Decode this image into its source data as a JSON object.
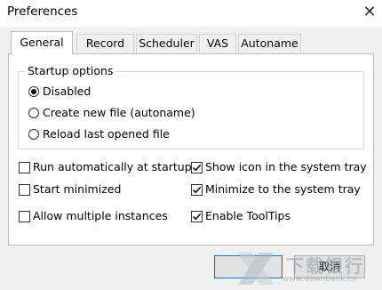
{
  "window": {
    "title": "Preferences"
  },
  "tabs": [
    {
      "label": "General",
      "active": true
    },
    {
      "label": "Record",
      "active": false
    },
    {
      "label": "Scheduler",
      "active": false
    },
    {
      "label": "VAS",
      "active": false
    },
    {
      "label": "Autoname",
      "active": false
    }
  ],
  "startup": {
    "legend": "Startup options",
    "options": [
      {
        "label": "Disabled",
        "selected": true
      },
      {
        "label": "Create new file (autoname)",
        "selected": false
      },
      {
        "label": "Reload last opened file",
        "selected": false
      }
    ]
  },
  "checkboxes": {
    "run_startup": {
      "label": "Run automatically at startup",
      "checked": false
    },
    "show_tray_icon": {
      "label": "Show icon in the system tray",
      "checked": true
    },
    "start_minimized": {
      "label": "Start minimized",
      "checked": false
    },
    "minimize_to_tray": {
      "label": "Minimize to the system tray",
      "checked": true
    },
    "multiple_instances": {
      "label": "Allow multiple instances",
      "checked": false
    },
    "tooltips": {
      "label": "Enable ToolTips",
      "checked": true
    }
  },
  "buttons": {
    "ok_label": "",
    "cancel_label": "取消"
  },
  "watermark": {
    "text": "下载银行",
    "url": "www.downbank.cn"
  },
  "colors": {
    "focus_border": "#0078d7",
    "panel_bg": "#ffffff",
    "window_bg": "#f0f0f0"
  }
}
